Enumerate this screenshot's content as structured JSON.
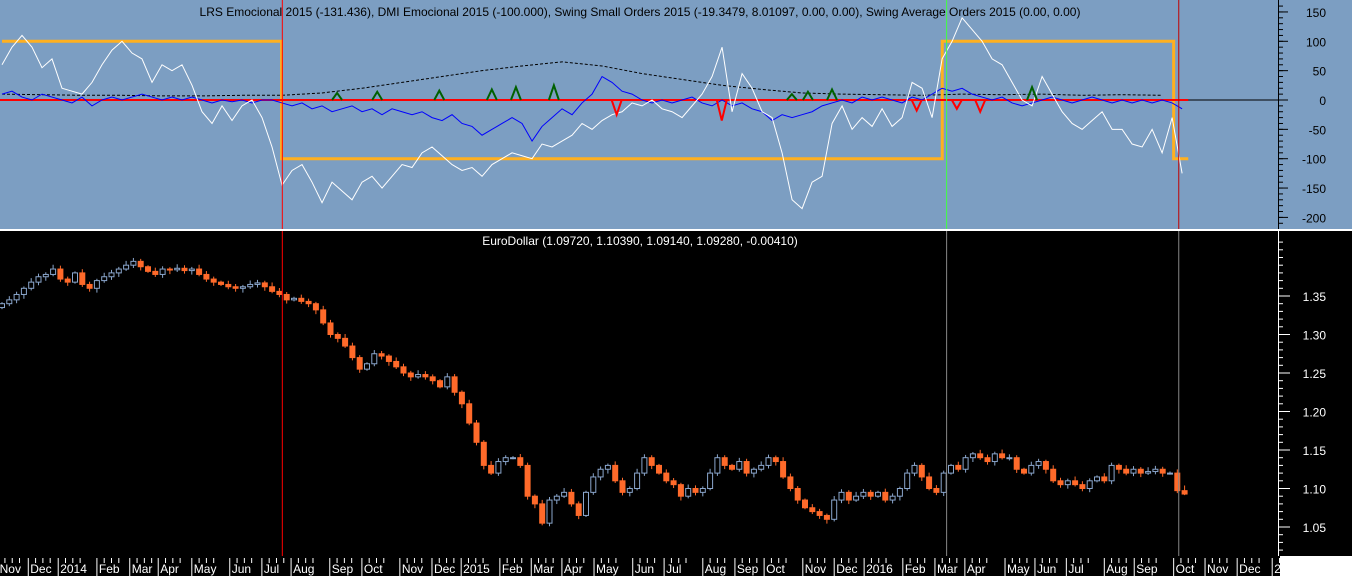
{
  "chart_data": [
    {
      "type": "line",
      "panel": "indicator",
      "title": "LRS Emocional 2015 (-131.436), DMI Emocional 2015 (-100.000), Swing Small Orders 2015 (-19.3479, 8.01097, 0.00, 0.00), Swing Average Orders 2015 (0.00, 0.00)",
      "ylim": [
        -220,
        170
      ],
      "yticks": [
        150,
        100,
        50,
        0,
        -50,
        -100,
        -150,
        -200
      ],
      "x_unit": "week index",
      "sample_step_weeks": 1.37,
      "series": [
        {
          "name": "LRS Emocional 2015",
          "color": "#ffffff",
          "values": [
            60,
            90,
            110,
            90,
            55,
            70,
            20,
            15,
            10,
            30,
            60,
            85,
            100,
            80,
            70,
            30,
            60,
            50,
            60,
            25,
            -20,
            -40,
            -10,
            -35,
            -10,
            0,
            -30,
            -80,
            -145,
            -120,
            -110,
            -140,
            -175,
            -140,
            -155,
            -170,
            -140,
            -130,
            -150,
            -130,
            -110,
            -115,
            -90,
            -80,
            -95,
            -110,
            -120,
            -115,
            -130,
            -110,
            -100,
            -90,
            -95,
            -100,
            -75,
            -80,
            -70,
            -60,
            -40,
            -50,
            -35,
            -25,
            -20,
            -5,
            -10,
            0,
            -15,
            -20,
            -30,
            -10,
            10,
            40,
            90,
            -20,
            45,
            20,
            -20,
            -30,
            -90,
            -170,
            -185,
            -140,
            -130,
            -40,
            -10,
            -50,
            -30,
            -45,
            -15,
            -45,
            -30,
            30,
            20,
            -30,
            70,
            100,
            140,
            120,
            100,
            70,
            60,
            30,
            0,
            -10,
            40,
            10,
            -20,
            -40,
            -50,
            -35,
            -20,
            -50,
            -50,
            -75,
            -80,
            -50,
            -90,
            -30,
            -125
          ]
        },
        {
          "name": "Swing Small Orders 2015",
          "color": "#0000ff",
          "values": [
            10,
            15,
            5,
            0,
            10,
            5,
            0,
            -5,
            5,
            -10,
            0,
            5,
            0,
            5,
            10,
            5,
            0,
            5,
            0,
            5,
            0,
            -5,
            0,
            -3,
            0,
            -5,
            0,
            0,
            -5,
            -10,
            -5,
            -15,
            -10,
            -20,
            -15,
            -10,
            -20,
            -15,
            -25,
            -15,
            -20,
            -25,
            -20,
            -30,
            -35,
            -25,
            -40,
            -45,
            -60,
            -50,
            -40,
            -30,
            -40,
            -70,
            -45,
            -30,
            -15,
            -25,
            -5,
            10,
            40,
            30,
            15,
            10,
            0,
            -5,
            0,
            -5,
            0,
            5,
            -5,
            -10,
            0,
            -10,
            -5,
            -15,
            -20,
            -35,
            -25,
            -30,
            -25,
            -20,
            -10,
            -5,
            0,
            -5,
            5,
            0,
            5,
            0,
            -5,
            5,
            0,
            10,
            20,
            15,
            20,
            10,
            5,
            0,
            5,
            -5,
            -10,
            -5,
            0,
            5,
            0,
            -5,
            0,
            5,
            0,
            -5,
            0,
            -5,
            0,
            -5,
            0,
            -5,
            -15
          ]
        },
        {
          "name": "Swing Small Orders average",
          "color": "#000000",
          "dashed": true,
          "sample_step_weeks": 5.48,
          "values": [
            10,
            9,
            8,
            8,
            7,
            7,
            8,
            8,
            12,
            20,
            30,
            40,
            50,
            58,
            65,
            58,
            45,
            35,
            25,
            18,
            12,
            10,
            9,
            8,
            10,
            9,
            10,
            8,
            9,
            8
          ]
        }
      ],
      "dmi_steps": [
        {
          "from_week": 0,
          "to_week": 38.3,
          "value": 100
        },
        {
          "from_week": 38.3,
          "to_week": 128.8,
          "value": -100
        },
        {
          "from_week": 128.8,
          "to_week": 160.5,
          "value": 100
        },
        {
          "from_week": 160.5,
          "to_week": 162.5,
          "value": -100
        }
      ],
      "dmi_color": "#ffb020",
      "zero_line_color": "#ff0000",
      "swing_markers": [
        {
          "week": 45.9,
          "type": "up",
          "value": 12
        },
        {
          "week": 51.4,
          "type": "up",
          "value": 14
        },
        {
          "week": 59.9,
          "type": "up",
          "value": 16
        },
        {
          "week": 67.1,
          "type": "up",
          "value": 18
        },
        {
          "week": 70.4,
          "type": "up",
          "value": 22
        },
        {
          "week": 75.6,
          "type": "up",
          "value": 25
        },
        {
          "week": 108.2,
          "type": "up",
          "value": 10
        },
        {
          "week": 110.4,
          "type": "up",
          "value": 14
        },
        {
          "week": 113.7,
          "type": "up",
          "value": 18
        },
        {
          "week": 141.1,
          "type": "up",
          "value": 22
        },
        {
          "week": 84.2,
          "type": "down",
          "value": -25
        },
        {
          "week": 98.6,
          "type": "down",
          "value": -35
        },
        {
          "week": 125.3,
          "type": "down",
          "value": -18
        },
        {
          "week": 130.8,
          "type": "down",
          "value": -15
        },
        {
          "week": 134.0,
          "type": "down",
          "value": -20
        }
      ],
      "up_marker_color": "#006000",
      "down_marker_color": "#ff0000"
    },
    {
      "type": "candlestick",
      "panel": "price",
      "title": "EuroDollar (1.09720, 1.10390, 1.09140, 1.09280, -0.00410)",
      "ylim": [
        1.015,
        1.44
      ],
      "yticks": [
        "1.35",
        "1.30",
        "1.25",
        "1.20",
        "1.15",
        "1.10",
        "1.05"
      ],
      "x_unit": "week index",
      "first_open": 1.335,
      "wick": 0.004,
      "up_color": "#8aa6cc",
      "down_color": "#ff6a2a",
      "last_bar": {
        "open": 1.0972,
        "high": 1.1039,
        "low": 1.0914,
        "close": 1.0928,
        "change": -0.0041
      },
      "closes": [
        1.34,
        1.345,
        1.352,
        1.36,
        1.368,
        1.375,
        1.378,
        1.385,
        1.372,
        1.368,
        1.38,
        1.365,
        1.36,
        1.37,
        1.375,
        1.38,
        1.385,
        1.39,
        1.395,
        1.388,
        1.382,
        1.378,
        1.385,
        1.384,
        1.386,
        1.383,
        1.385,
        1.378,
        1.372,
        1.368,
        1.365,
        1.362,
        1.36,
        1.362,
        1.365,
        1.367,
        1.362,
        1.356,
        1.352,
        1.345,
        1.347,
        1.343,
        1.34,
        1.332,
        1.315,
        1.3,
        1.295,
        1.285,
        1.27,
        1.255,
        1.262,
        1.275,
        1.272,
        1.265,
        1.258,
        1.25,
        1.245,
        1.248,
        1.245,
        1.24,
        1.232,
        1.245,
        1.225,
        1.21,
        1.185,
        1.16,
        1.13,
        1.12,
        1.135,
        1.14,
        1.14,
        1.13,
        1.09,
        1.08,
        1.055,
        1.085,
        1.09,
        1.095,
        1.08,
        1.065,
        1.095,
        1.115,
        1.125,
        1.13,
        1.11,
        1.095,
        1.1,
        1.12,
        1.14,
        1.13,
        1.12,
        1.11,
        1.105,
        1.09,
        1.1,
        1.095,
        1.1,
        1.12,
        1.14,
        1.13,
        1.125,
        1.135,
        1.12,
        1.125,
        1.13,
        1.14,
        1.135,
        1.115,
        1.1,
        1.085,
        1.075,
        1.07,
        1.065,
        1.06,
        1.085,
        1.095,
        1.085,
        1.09,
        1.095,
        1.09,
        1.095,
        1.085,
        1.09,
        1.1,
        1.12,
        1.13,
        1.115,
        1.1,
        1.095,
        1.12,
        1.13,
        1.125,
        1.14,
        1.145,
        1.14,
        1.135,
        1.145,
        1.14,
        1.14,
        1.125,
        1.12,
        1.13,
        1.135,
        1.125,
        1.11,
        1.105,
        1.11,
        1.105,
        1.1,
        1.11,
        1.115,
        1.11,
        1.13,
        1.125,
        1.12,
        1.125,
        1.12,
        1.122,
        1.125,
        1.12,
        1.12,
        1.0972,
        1.0928
      ]
    }
  ],
  "time_axis": {
    "labels": [
      {
        "text": "Nov",
        "week": -0.6
      },
      {
        "text": "Dec",
        "week": 3.6
      },
      {
        "text": "2014",
        "week": 7.7
      },
      {
        "text": "Feb",
        "week": 13.0
      },
      {
        "text": "Mar",
        "week": 17.5
      },
      {
        "text": "Apr",
        "week": 21.4
      },
      {
        "text": "May",
        "week": 26.0
      },
      {
        "text": "Jun",
        "week": 31.2
      },
      {
        "text": "Jul",
        "week": 35.6
      },
      {
        "text": "Aug",
        "week": 39.6
      },
      {
        "text": "Sep",
        "week": 44.9
      },
      {
        "text": "Oct",
        "week": 49.3
      },
      {
        "text": "Nov",
        "week": 54.5
      },
      {
        "text": "Dec",
        "week": 58.9
      },
      {
        "text": "2015",
        "week": 62.9
      },
      {
        "text": "Feb",
        "week": 68.2
      },
      {
        "text": "Mar",
        "week": 72.5
      },
      {
        "text": "Apr",
        "week": 76.7
      },
      {
        "text": "May",
        "week": 81.1
      },
      {
        "text": "Jun",
        "week": 86.4
      },
      {
        "text": "Jul",
        "week": 90.7
      },
      {
        "text": "Aug",
        "week": 96.0
      },
      {
        "text": "Sep",
        "week": 100.4
      },
      {
        "text": "Oct",
        "week": 104.4
      },
      {
        "text": "Nov",
        "week": 109.7
      },
      {
        "text": "Dec",
        "week": 114.0
      },
      {
        "text": "2016",
        "week": 118.1
      },
      {
        "text": "Feb",
        "week": 123.4
      },
      {
        "text": "Mar",
        "week": 127.8
      },
      {
        "text": "Apr",
        "week": 131.9
      },
      {
        "text": "May",
        "week": 137.4
      },
      {
        "text": "Jun",
        "week": 141.5
      },
      {
        "text": "Jul",
        "week": 145.8
      },
      {
        "text": "Aug",
        "week": 151.0
      },
      {
        "text": "Sep",
        "week": 155.1
      },
      {
        "text": "Oct",
        "week": 160.5
      },
      {
        "text": "Nov",
        "week": 164.8
      },
      {
        "text": "Dec",
        "week": 169.2
      },
      {
        "text": "2",
        "week": 174.0
      }
    ]
  },
  "cursor_lines": [
    {
      "week": 38.4,
      "color": "#ff0000"
    },
    {
      "week": 129.4,
      "color": "#40ff40"
    },
    {
      "week": 161.2,
      "color": "#c00000"
    }
  ],
  "colors": {
    "indicator_bg": "#7c9ec2",
    "price_bg": "#000000"
  }
}
